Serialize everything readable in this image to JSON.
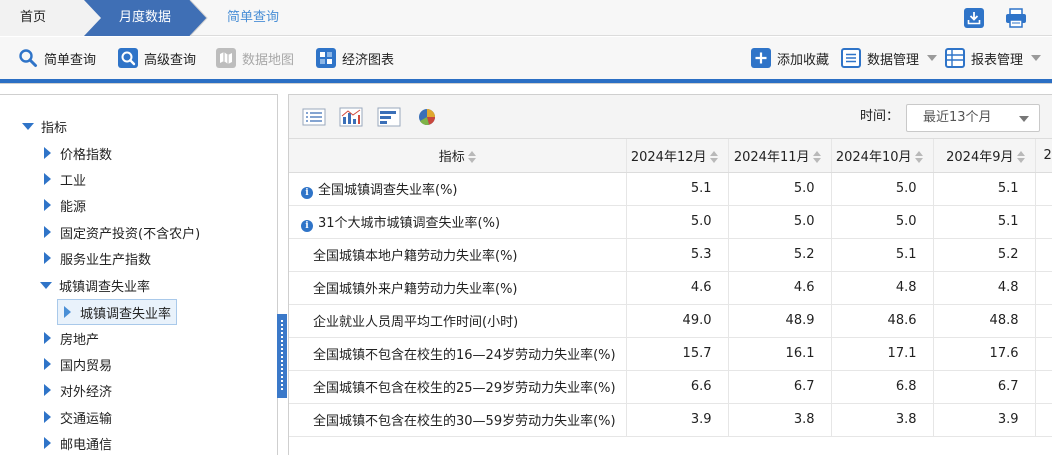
{
  "breadcrumb": {
    "home": "首页",
    "month": "月度数据",
    "simple": "简单查询"
  },
  "toolbar": {
    "simple_query": "简单查询",
    "advanced_query": "高级查询",
    "data_map": "数据地图",
    "econ_chart": "经济图表",
    "add_favorite": "添加收藏",
    "data_manage": "数据管理",
    "report_manage": "报表管理"
  },
  "tree": {
    "root": "指标",
    "items": [
      "价格指数",
      "工业",
      "能源",
      "固定资产投资(不含农户)",
      "服务业生产指数",
      "城镇调查失业率",
      "房地产",
      "国内贸易",
      "对外经济",
      "交通运输",
      "邮电通信"
    ],
    "selected_child": "城镇调查失业率"
  },
  "filter": {
    "time_label": "时间：",
    "time_value": "最近13个月"
  },
  "table": {
    "headers": [
      "指标",
      "2024年12月",
      "2024年11月",
      "2024年10月",
      "2024年9月",
      "2"
    ],
    "rows": [
      {
        "name": "全国城镇调查失业率(%)",
        "info": true,
        "values": [
          "5.1",
          "5.0",
          "5.0",
          "5.1"
        ]
      },
      {
        "name": "31个大城市城镇调查失业率(%)",
        "info": true,
        "values": [
          "5.0",
          "5.0",
          "5.0",
          "5.1"
        ]
      },
      {
        "name": "全国城镇本地户籍劳动力失业率(%)",
        "info": false,
        "values": [
          "5.3",
          "5.2",
          "5.1",
          "5.2"
        ]
      },
      {
        "name": "全国城镇外来户籍劳动力失业率(%)",
        "info": false,
        "values": [
          "4.6",
          "4.6",
          "4.8",
          "4.8"
        ]
      },
      {
        "name": "企业就业人员周平均工作时间(小时)",
        "info": false,
        "values": [
          "49.0",
          "48.9",
          "48.6",
          "48.8"
        ]
      },
      {
        "name": "全国城镇不包含在校生的16—24岁劳动力失业率(%)",
        "info": false,
        "values": [
          "15.7",
          "16.1",
          "17.1",
          "17.6"
        ]
      },
      {
        "name": "全国城镇不包含在校生的25—29岁劳动力失业率(%)",
        "info": false,
        "values": [
          "6.6",
          "6.7",
          "6.8",
          "6.7"
        ]
      },
      {
        "name": "全国城镇不包含在校生的30—59岁劳动力失业率(%)",
        "info": false,
        "values": [
          "3.9",
          "3.8",
          "3.8",
          "3.9"
        ]
      }
    ]
  },
  "colors": {
    "accent": "#2b6fc4",
    "crumb_active": "#3f6fb5",
    "link": "#4a8fd6"
  }
}
